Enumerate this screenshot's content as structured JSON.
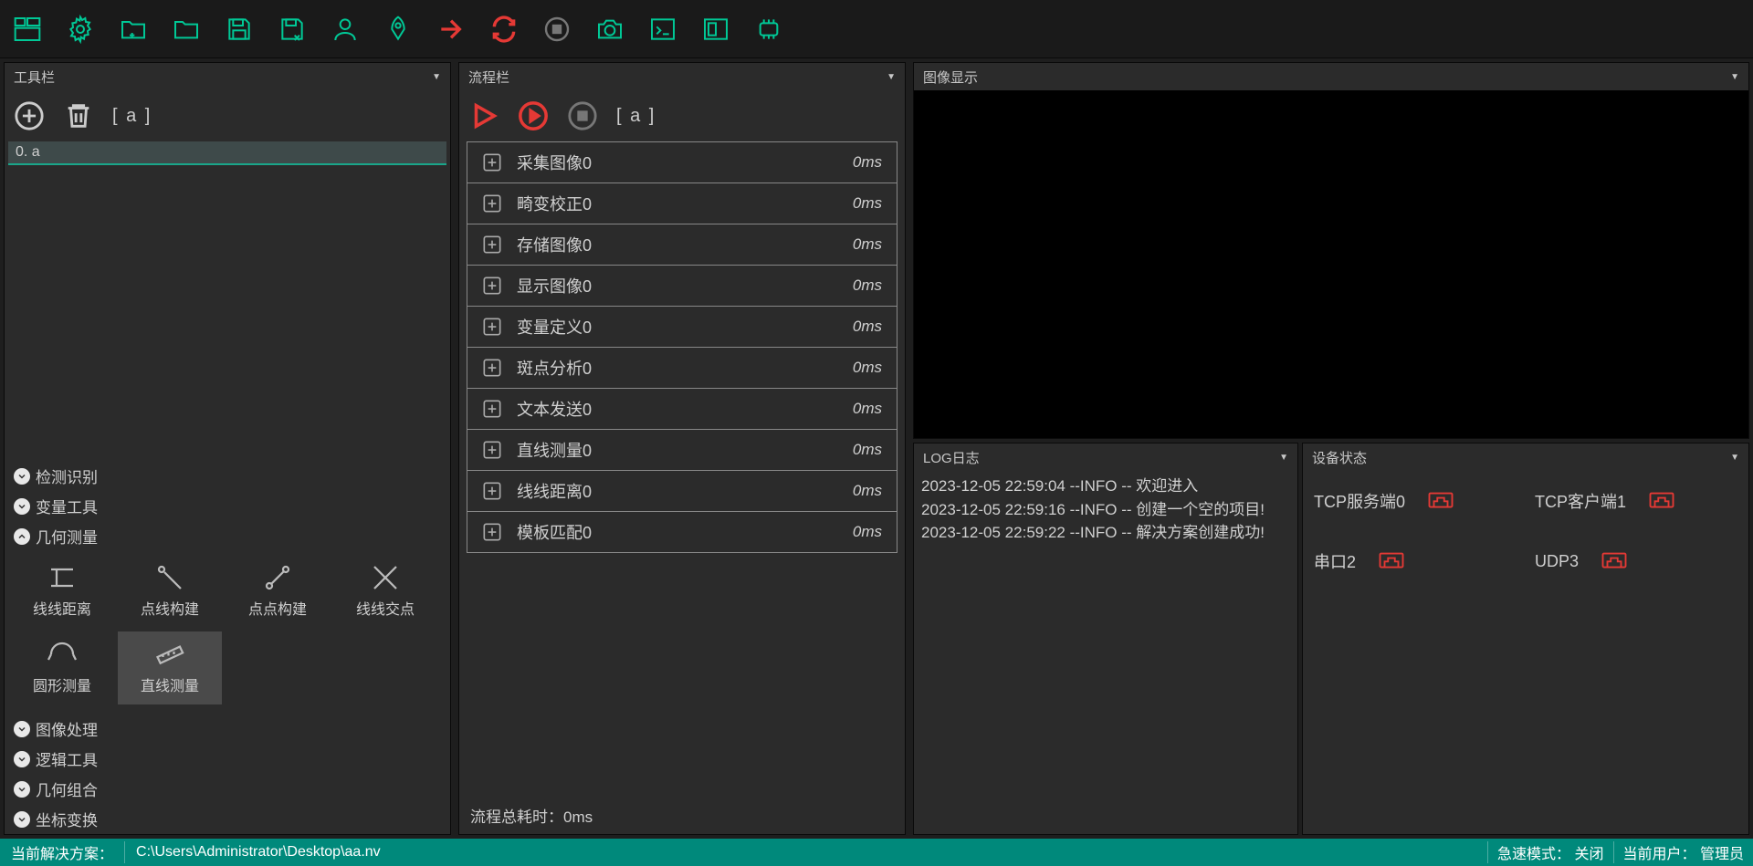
{
  "toolbar_icons": [
    "layout",
    "gear",
    "folder-open",
    "folder",
    "save",
    "save-as",
    "user",
    "rocket",
    "arrow-right",
    "loop",
    "stop",
    "camera",
    "console",
    "panel",
    "chip"
  ],
  "left": {
    "title": "工具栏",
    "bracket": "[  a  ]",
    "items": [
      {
        "idx": "0.",
        "name": "a",
        "sel": true
      }
    ]
  },
  "categories": [
    {
      "name": "检测识别",
      "open": false
    },
    {
      "name": "变量工具",
      "open": false
    },
    {
      "name": "几何测量",
      "open": true,
      "tools": [
        {
          "name": "线线距离",
          "sel": false
        },
        {
          "name": "点线构建",
          "sel": false
        },
        {
          "name": "点点构建",
          "sel": false
        },
        {
          "name": "线线交点",
          "sel": false
        },
        {
          "name": "圆形测量",
          "sel": false
        },
        {
          "name": "直线测量",
          "sel": true
        }
      ]
    },
    {
      "name": "图像处理",
      "open": false
    },
    {
      "name": "逻辑工具",
      "open": false
    },
    {
      "name": "几何组合",
      "open": false
    },
    {
      "name": "坐标变换",
      "open": false
    }
  ],
  "flow": {
    "title": "流程栏",
    "bracket": "[  a  ]",
    "steps": [
      {
        "name": "采集图像0",
        "time": "0ms"
      },
      {
        "name": "畸变校正0",
        "time": "0ms"
      },
      {
        "name": "存储图像0",
        "time": "0ms"
      },
      {
        "name": "显示图像0",
        "time": "0ms"
      },
      {
        "name": "变量定义0",
        "time": "0ms"
      },
      {
        "name": "斑点分析0",
        "time": "0ms"
      },
      {
        "name": "文本发送0",
        "time": "0ms"
      },
      {
        "name": "直线测量0",
        "time": "0ms"
      },
      {
        "name": "线线距离0",
        "time": "0ms"
      },
      {
        "name": "模板匹配0",
        "time": "0ms"
      }
    ],
    "total_label": "流程总耗时：",
    "total_value": "0ms"
  },
  "image_display": {
    "title": "图像显示"
  },
  "log": {
    "title": "LOG日志",
    "body": "2023-12-05 22:59:04 --INFO -- 欢迎进入\n2023-12-05 22:59:16 --INFO -- 创建一个空的项目!\n2023-12-05 22:59:22 --INFO -- 解决方案创建成功!"
  },
  "devices": {
    "title": "设备状态",
    "items": [
      {
        "name": "TCP服务端0"
      },
      {
        "name": "TCP客户端1"
      },
      {
        "name": "串口2"
      },
      {
        "name": "UDP3"
      }
    ]
  },
  "status": {
    "sol_label": "当前解决方案：",
    "path": "C:\\Users\\Administrator\\Desktop\\aa.nv",
    "rapid_label": "急速模式：",
    "rapid_value": "关闭",
    "user_label": "当前用户：",
    "user_value": "管理员"
  }
}
